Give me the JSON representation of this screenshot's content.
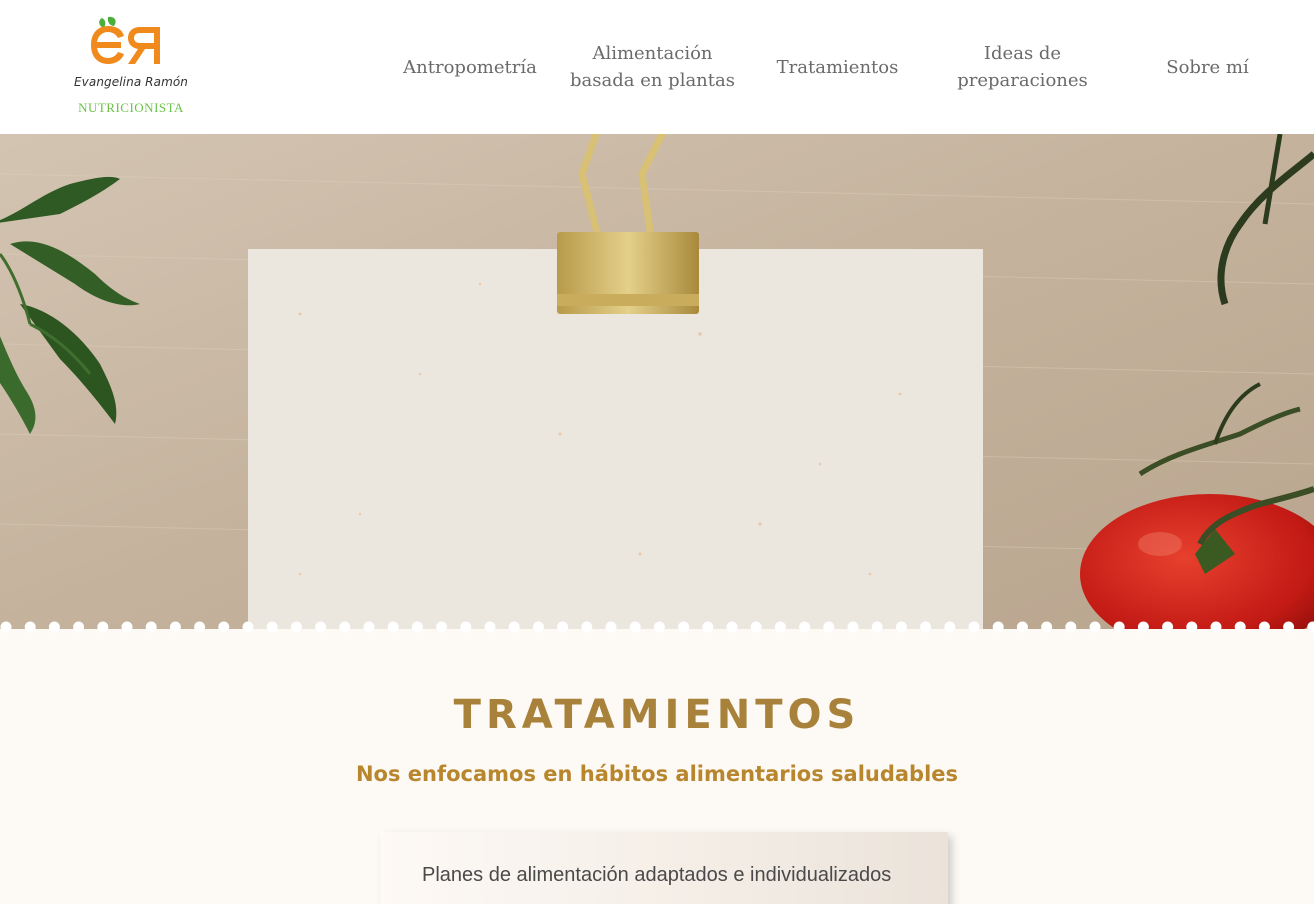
{
  "brand": {
    "initials": "ЄR",
    "name": "Evangelina  Ramón",
    "role": "NUTRICIONISTA",
    "accent_color": "#f08a1c",
    "leaf_color": "#4caf3c"
  },
  "nav": {
    "items": [
      {
        "label_line1": "Antropometría",
        "label_line2": ""
      },
      {
        "label_line1": "Alimentación",
        "label_line2": "basada en plantas"
      },
      {
        "label_line1": "Tratamientos",
        "label_line2": ""
      },
      {
        "label_line1": "Ideas de",
        "label_line2": "preparaciones"
      },
      {
        "label_line1": "Sobre mí",
        "label_line2": ""
      }
    ]
  },
  "hero": {
    "image": "hero-photo-clipboard-parsley-tomato"
  },
  "section": {
    "title": "TRATAMIENTOS",
    "subtitle": "Nos enfocamos en hábitos alimentarios saludables",
    "card_text": "Planes de alimentación adaptados e individualizados",
    "title_color": "#a8823a",
    "subtitle_color": "#b8862c"
  }
}
